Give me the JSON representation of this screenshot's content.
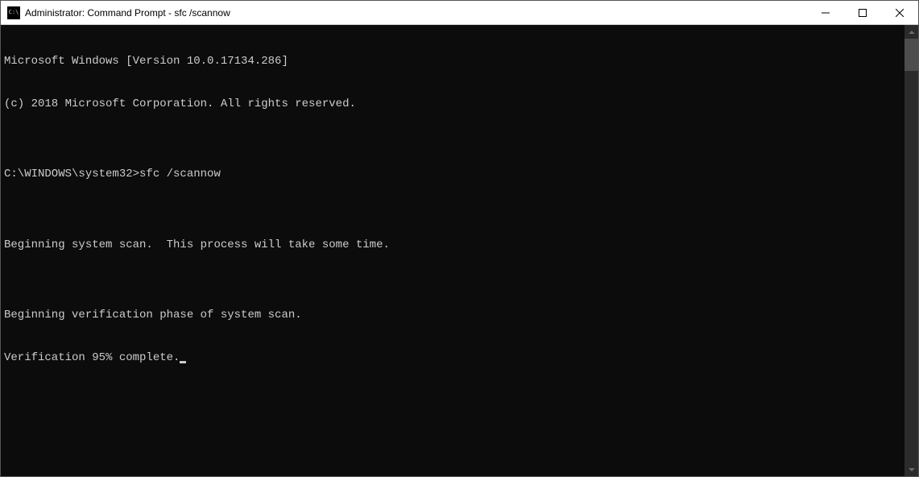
{
  "window": {
    "title": "Administrator: Command Prompt - sfc  /scannow"
  },
  "terminal": {
    "lines": [
      "Microsoft Windows [Version 10.0.17134.286]",
      "(c) 2018 Microsoft Corporation. All rights reserved.",
      "",
      "C:\\WINDOWS\\system32>sfc /scannow",
      "",
      "Beginning system scan.  This process will take some time.",
      "",
      "Beginning verification phase of system scan.",
      "Verification 95% complete."
    ]
  }
}
